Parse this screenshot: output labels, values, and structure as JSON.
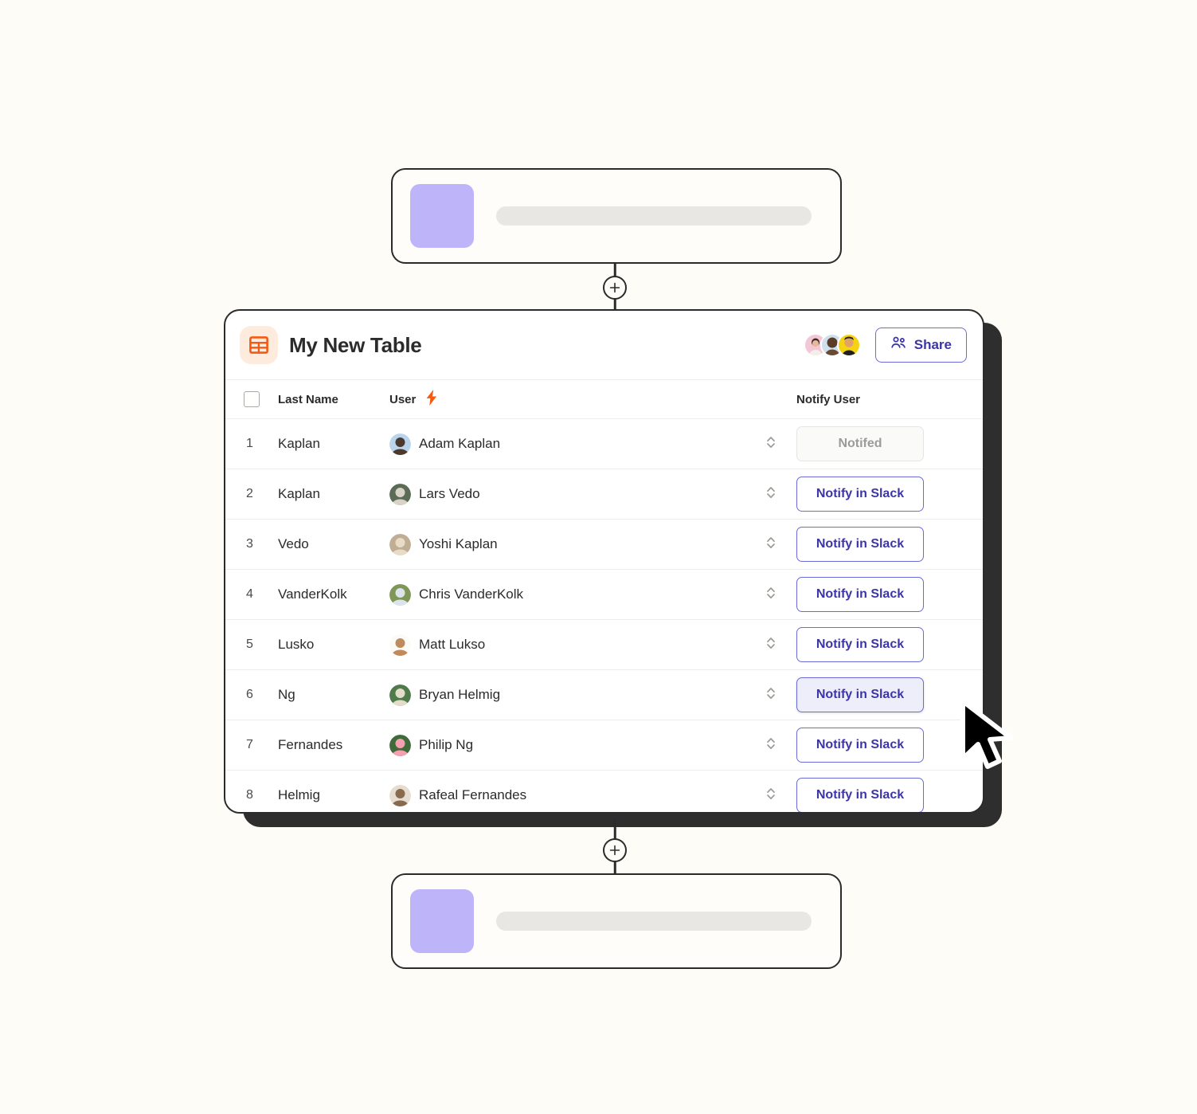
{
  "canvas": {
    "background": "#FDFCF7"
  },
  "steps": {
    "top": {
      "name": "step-card-top",
      "thumb_color": "#BDB4FA",
      "bar_color": "#E8E7E4"
    },
    "bottom": {
      "name": "step-card-bottom",
      "thumb_color": "#BDB4FA",
      "bar_color": "#E8E7E4"
    },
    "add_label": "+"
  },
  "panel": {
    "title": "My New Table",
    "icon": "table-icon",
    "icon_color": "#F45A14",
    "icon_bg": "#FDEBDD",
    "share": {
      "label": "Share",
      "icon": "people-icon",
      "color": "#3B35A8",
      "border_color": "#6A6ADB"
    },
    "collaborators": [
      {
        "name": "collaborator-avatar-1",
        "bg": "#F4C7D4"
      },
      {
        "name": "collaborator-avatar-2",
        "bg": "#6B4A32"
      },
      {
        "name": "collaborator-avatar-3",
        "bg": "#F5D313"
      }
    ]
  },
  "table": {
    "columns": {
      "checkbox": "",
      "number": "",
      "last_name": "Last Name",
      "user": "User",
      "user_icon": "lightning-bolt-icon",
      "notify": "Notify User"
    },
    "accent": "#3B35A8",
    "rows": [
      {
        "num": "1",
        "last_name": "Kaplan",
        "user": "Adam Kaplan",
        "avatar_bg": "#BBD4EE",
        "avatar_fg": "#4A3A2E",
        "action_label": "Notifed",
        "action_state": "done"
      },
      {
        "num": "2",
        "last_name": "Kaplan",
        "user": "Lars Vedo",
        "avatar_bg": "#5C6B55",
        "avatar_fg": "#D8D3C6",
        "action_label": "Notify in Slack",
        "action_state": "default"
      },
      {
        "num": "3",
        "last_name": "Vedo",
        "user": "Yoshi Kaplan",
        "avatar_bg": "#BFAE93",
        "avatar_fg": "#E8DCC6",
        "action_label": "Notify in Slack",
        "action_state": "default"
      },
      {
        "num": "4",
        "last_name": "VanderKolk",
        "user": "Chris VanderKolk",
        "avatar_bg": "#7E9656",
        "avatar_fg": "#DCE3EC",
        "action_label": "Notify in Slack",
        "action_state": "default"
      },
      {
        "num": "5",
        "last_name": "Lusko",
        "user": "Matt Lukso",
        "avatar_bg": "#FBFAF7",
        "avatar_fg": "#C08B5C",
        "action_label": "Notify in Slack",
        "action_state": "default"
      },
      {
        "num": "6",
        "last_name": "Ng",
        "user": "Bryan Helmig",
        "avatar_bg": "#4F7A4A",
        "avatar_fg": "#E3DCC8",
        "action_label": "Notify in Slack",
        "action_state": "hovered"
      },
      {
        "num": "7",
        "last_name": "Fernandes",
        "user": "Philip Ng",
        "avatar_bg": "#3F6B3A",
        "avatar_fg": "#F4A0AE",
        "action_label": "Notify in Slack",
        "action_state": "default"
      },
      {
        "num": "8",
        "last_name": "Helmig",
        "user": "Rafeal Fernandes",
        "avatar_bg": "#E6DCD0",
        "avatar_fg": "#8A6A4E",
        "action_label": "Notify in Slack",
        "action_state": "default"
      }
    ],
    "sort_icon": "chevron-up-down-icon"
  },
  "cursor": {
    "name": "mouse-pointer",
    "color": "#000000"
  }
}
